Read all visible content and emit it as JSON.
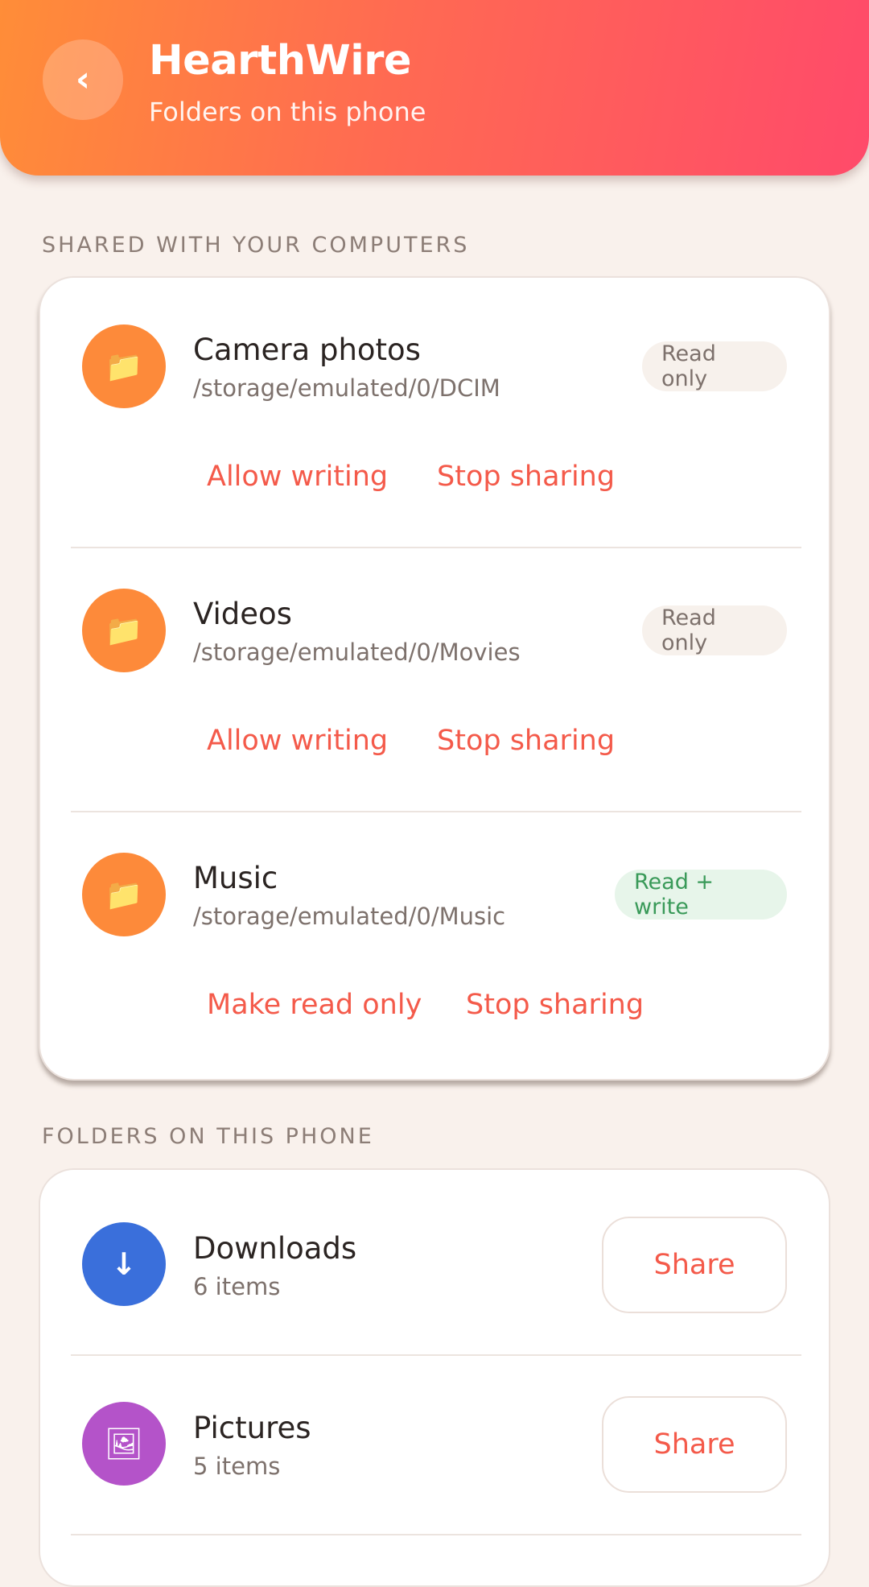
{
  "header": {
    "back_glyph": "‹",
    "title": "HearthWire",
    "subtitle": "Folders on this phone"
  },
  "shared_section": {
    "label": "SHARED WITH YOUR COMPUTERS",
    "folders": [
      {
        "icon": "folder-icon",
        "glyph": "📁",
        "name": "Camera photos",
        "path": "/storage/emulated/0/DCIM",
        "badge": "Read only",
        "primary_action": "Allow writing",
        "secondary_action": "Stop sharing"
      },
      {
        "icon": "folder-icon",
        "glyph": "📁",
        "name": "Videos",
        "path": "/storage/emulated/0/Movies",
        "badge": "Read only",
        "primary_action": "Allow writing",
        "secondary_action": "Stop sharing"
      },
      {
        "icon": "folder-icon",
        "glyph": "📁",
        "name": "Music",
        "path": "/storage/emulated/0/Music",
        "badge": "Read + write",
        "primary_action": "Make read only",
        "secondary_action": "Stop sharing"
      }
    ]
  },
  "phone_section": {
    "label": "FOLDERS ON THIS PHONE",
    "folders": [
      {
        "icon": "download-arrow-icon",
        "glyph": "↓",
        "name": "Downloads",
        "count": "6 items",
        "action": "Share"
      },
      {
        "icon": "picture-frame-icon",
        "glyph": "🖼",
        "name": "Pictures",
        "count": "5 items",
        "action": "Share"
      }
    ]
  },
  "colors": {
    "accent": "#f45a4a",
    "header_gradient_start": "#ff8d38",
    "header_gradient_end": "#ff4a6a",
    "folder_orange": "#fd8a3a",
    "downloads_blue": "#3a6fdb",
    "pictures_purple": "#b453c9",
    "read_write_green": "#3a9a59"
  }
}
